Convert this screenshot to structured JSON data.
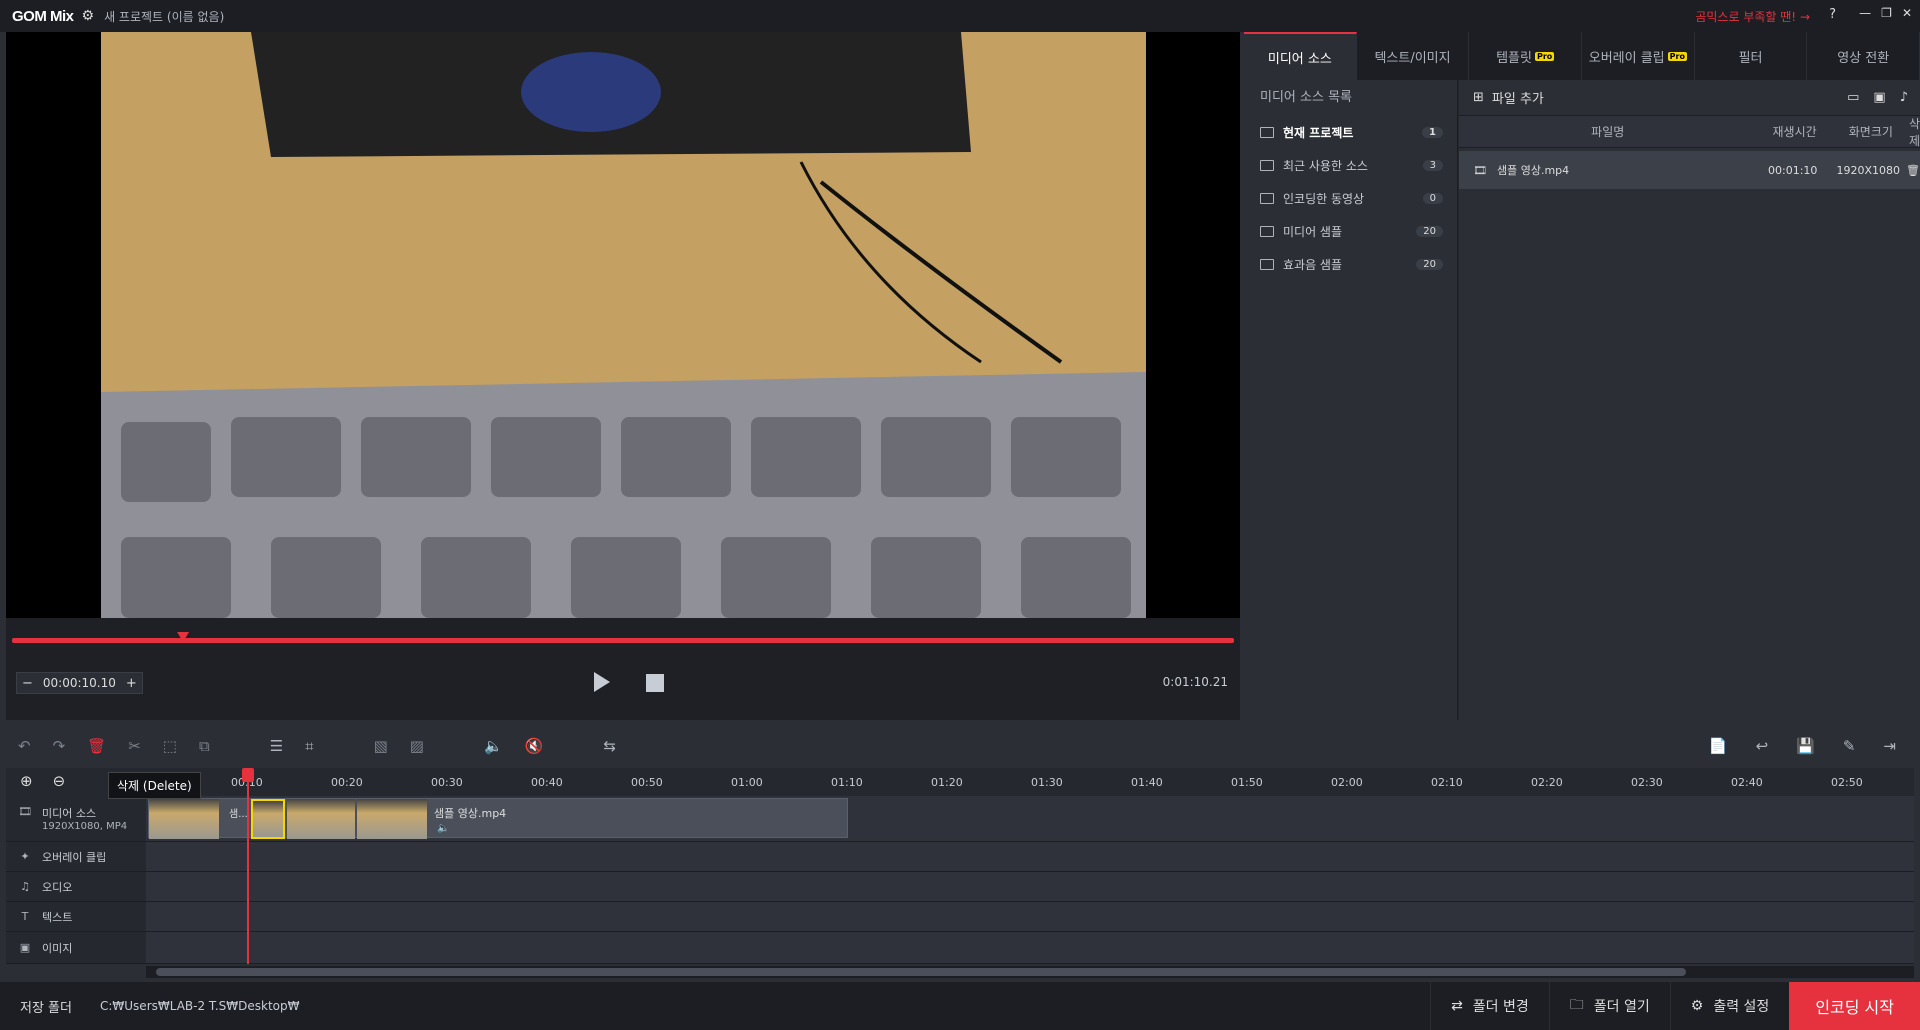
{
  "titlebar": {
    "app_name": "GOM Mix",
    "project_title": "새 프로젝트 (이름 없음)",
    "promo_text": "곰믹스로 부족할 땐!",
    "help_label": "?"
  },
  "preview": {
    "current_time": "00:00:10.10",
    "total_time": "0:01:10.21",
    "progress_fraction": 0.14
  },
  "right_panel": {
    "tabs": [
      {
        "label": "미디어 소스",
        "pro": ""
      },
      {
        "label": "텍스트/이미지",
        "pro": ""
      },
      {
        "label": "템플릿",
        "pro": "Pro"
      },
      {
        "label": "오버레이 클립",
        "pro": "Pro"
      },
      {
        "label": "필터",
        "pro": ""
      },
      {
        "label": "영상 전환",
        "pro": ""
      }
    ],
    "source_list_title": "미디어 소스 목록",
    "sources": [
      {
        "label": "현재 프로젝트",
        "count": "1"
      },
      {
        "label": "최근 사용한 소스",
        "count": "3"
      },
      {
        "label": "인코딩한 동영상",
        "count": "0"
      },
      {
        "label": "미디어 샘플",
        "count": "20"
      },
      {
        "label": "효과음 샘플",
        "count": "20"
      }
    ],
    "add_file_label": "파일 추가",
    "columns": {
      "name": "파일명",
      "duration": "재생시간",
      "size": "화면크기",
      "delete": "삭제"
    },
    "files": [
      {
        "name": "샘플 영상.mp4",
        "duration": "00:01:10",
        "size": "1920X1080"
      }
    ]
  },
  "timeline": {
    "ticks": [
      "00:10",
      "00:20",
      "00:30",
      "00:40",
      "00:50",
      "01:00",
      "01:10",
      "01:20",
      "01:30",
      "01:40",
      "01:50",
      "02:00",
      "02:10",
      "02:20",
      "02:30",
      "02:40",
      "02:50"
    ],
    "tooltip": "삭제 (Delete)",
    "tracks": [
      {
        "label": "미디어 소스",
        "sub": "1920X1080, MP4"
      },
      {
        "label": "오버레이 클립",
        "sub": ""
      },
      {
        "label": "오디오",
        "sub": ""
      },
      {
        "label": "텍스트",
        "sub": ""
      },
      {
        "label": "이미지",
        "sub": ""
      }
    ],
    "clip_label": "샘플 영상.mp4",
    "clip_short": "샘..."
  },
  "bottom": {
    "save_folder_label": "저장 폴더",
    "path": "C:₩Users₩LAB-2 T.S₩Desktop₩",
    "change_folder": "폴더 변경",
    "open_folder": "폴더 열기",
    "output_settings": "출력 설정",
    "encode_start": "인코딩 시작"
  },
  "colors": {
    "accent": "#e5323e",
    "pro_badge": "#f5d800"
  }
}
